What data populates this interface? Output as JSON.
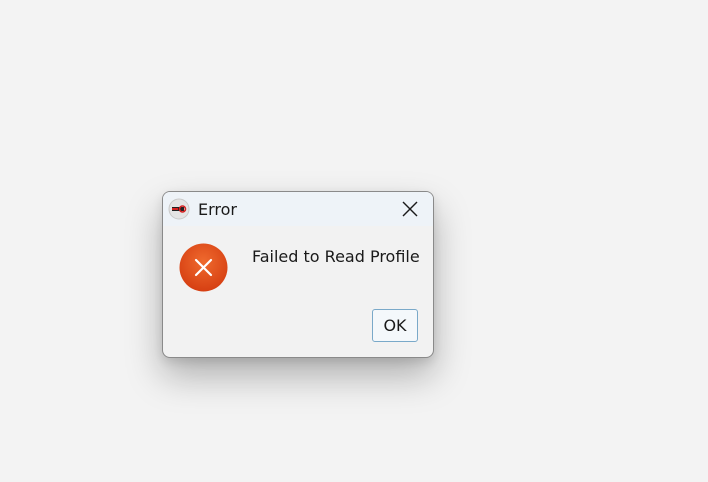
{
  "dialog": {
    "title": "Error",
    "app_icon": "app-logo-icon",
    "close_icon": "close-icon",
    "status_icon": "error-icon",
    "message": "Failed to Read Profile",
    "ok_label": "OK"
  },
  "colors": {
    "error": "#e2481a",
    "accent_border": "#7aa9c9"
  }
}
